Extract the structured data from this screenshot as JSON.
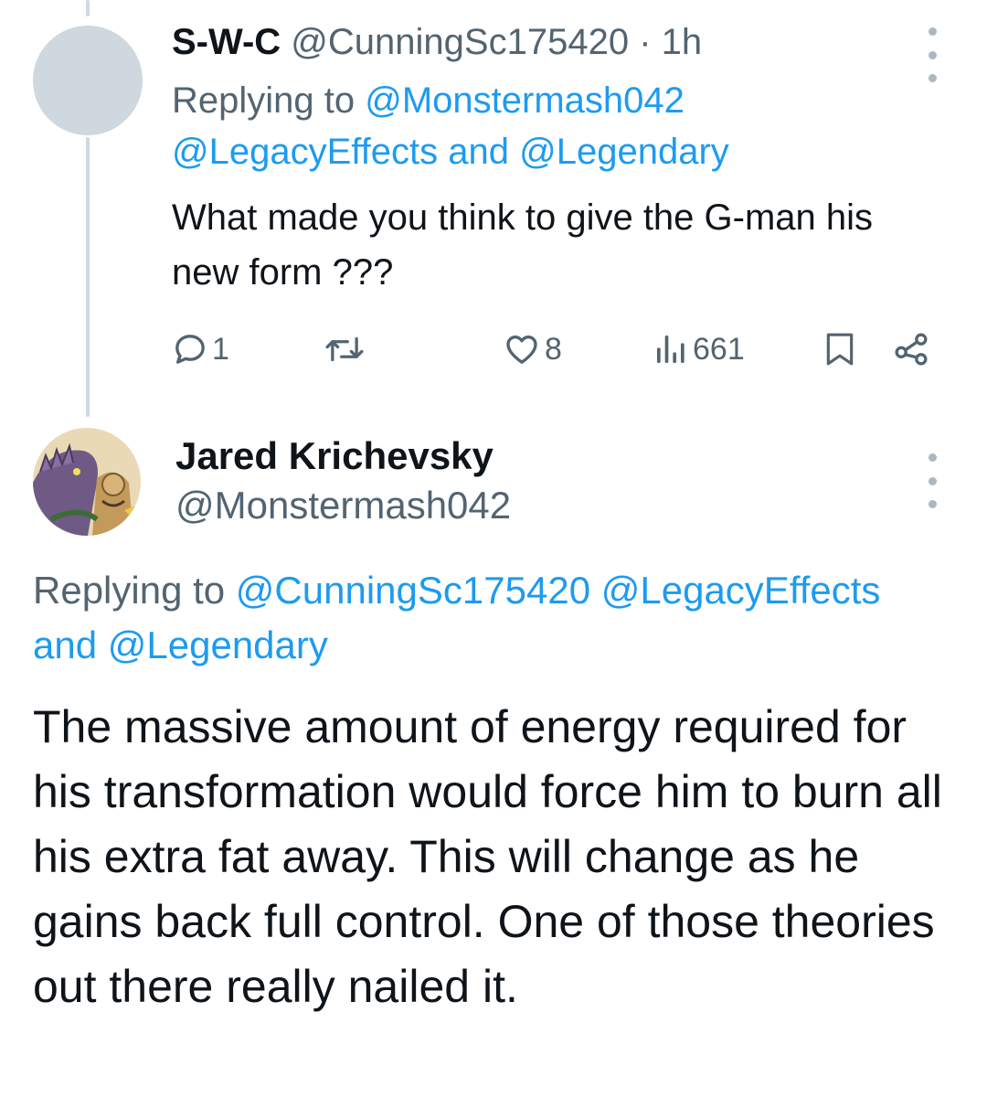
{
  "tweet1": {
    "name": "S-W-C",
    "handle": "@CunningSc175420",
    "separator": "·",
    "time": "1h",
    "replying_prefix": "Replying to",
    "mention1": "@Monstermash042",
    "mention2": "@LegacyEffects",
    "and": "and",
    "mention3": "@Legendary",
    "text": "What made you think to give the G-man his new form ???",
    "actions": {
      "reply_icon": "reply-icon",
      "reply_count": "1",
      "retweet_icon": "retweet-icon",
      "like_icon": "heart-icon",
      "like_count": "8",
      "views_icon": "views-icon",
      "views_count": "661",
      "bookmark_icon": "bookmark-icon",
      "share_icon": "share-icon"
    }
  },
  "tweet2": {
    "name": "Jared Krichevsky",
    "handle": "@Monstermash042",
    "replying_prefix": "Replying to",
    "mention1": "@CunningSc175420",
    "mention2": "@LegacyEffects",
    "and": "and",
    "mention3": "@Legendary",
    "text": "The massive amount of energy required for his transformation would force him to burn all his extra fat away. This will change as he gains back full control. One of those theories out there really nailed it."
  },
  "colors": {
    "text": "#0f1419",
    "secondary": "#536471",
    "link": "#1d9bf0",
    "thread_line": "#cfd9de"
  }
}
